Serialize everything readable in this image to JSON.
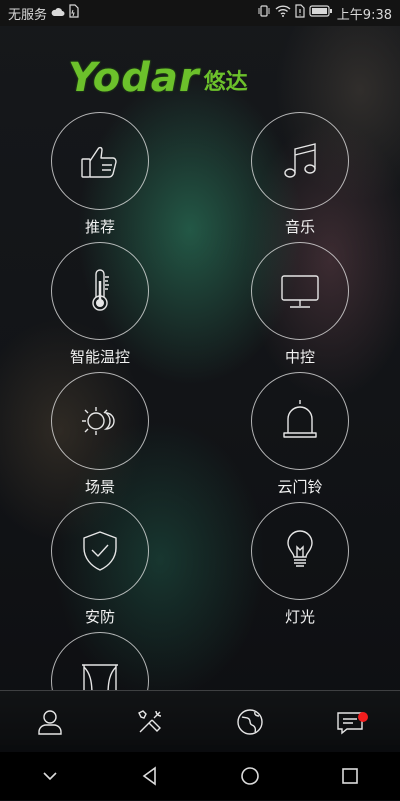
{
  "status_bar": {
    "carrier": "无服务",
    "time": "上午9:38"
  },
  "logo": {
    "text": "Yodar",
    "cn": "悠达"
  },
  "tiles": [
    {
      "label": "推荐",
      "icon": "thumbs-up-icon"
    },
    {
      "label": "音乐",
      "icon": "music-note-icon"
    },
    {
      "label": "智能温控",
      "icon": "thermometer-icon"
    },
    {
      "label": "中控",
      "icon": "monitor-icon"
    },
    {
      "label": "场景",
      "icon": "sun-moon-icon"
    },
    {
      "label": "云门铃",
      "icon": "bell-icon"
    },
    {
      "label": "安防",
      "icon": "shield-check-icon"
    },
    {
      "label": "灯光",
      "icon": "light-bulb-icon"
    },
    {
      "label": "",
      "icon": "curtain-icon"
    }
  ],
  "bottom_nav": {
    "items": [
      "user-icon",
      "tools-icon",
      "globe-icon",
      "message-icon"
    ],
    "badge_color": "#f21d1d"
  },
  "colors": {
    "brand_green": "#6cc12b",
    "icon_stroke": "#e6e6e6"
  }
}
